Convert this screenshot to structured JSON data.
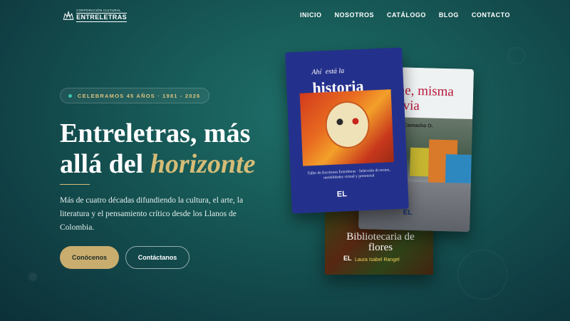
{
  "nav": {
    "logo": {
      "small_text": "CORPORACIÓN CULTURAL",
      "big_text": "ENTRELETRAS",
      "icon": "crown-logo-icon"
    },
    "items": [
      {
        "label": "INICIO"
      },
      {
        "label": "NOSOTROS"
      },
      {
        "label": "CATÁLOGO"
      },
      {
        "label": "BLOG"
      },
      {
        "label": "CONTACTO"
      }
    ]
  },
  "hero": {
    "badge": "CELEBRAMOS 45 AÑOS · 1981 - 2026",
    "title_plain": "Entreletras, más allá del ",
    "title_highlight": "horizonte",
    "description": "Más de cuatro décadas difundiendo la cultura, el arte, la literatura y el pensamiento crítico desde los Llanos de Colombia.",
    "primary_button": "Conócenos",
    "secondary_button": "Contáctanos"
  },
  "books": {
    "historia": {
      "title_line1": "Ahí",
      "title_small": "está la",
      "title_line2": "historia",
      "subtitle": "Taller de Escritores Entreletras · Selección de textos, modalidades virtual y presencial",
      "logo": "EL"
    },
    "che": {
      "title": "Che, misma lluvia",
      "author": "Camacho O.",
      "logo": "EL"
    },
    "flores": {
      "title": "Bibliotecaria de flores",
      "author": "Laura Isabel Rangel",
      "logo": "EL"
    }
  },
  "colors": {
    "accent_gold": "#c9ad6e",
    "badge_dot": "#3cc4a8",
    "background": "#175a57"
  }
}
